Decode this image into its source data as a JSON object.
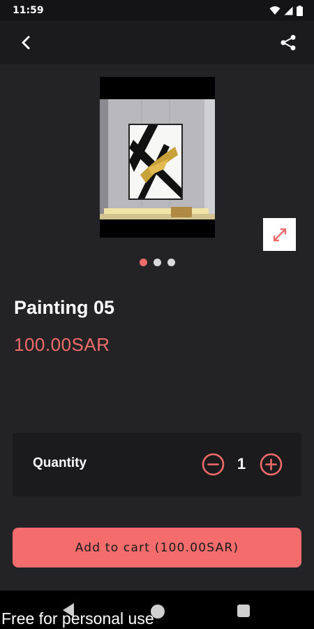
{
  "status_bar": {
    "time": "11:59",
    "icons": [
      "wifi-icon",
      "signal-icon",
      "battery-icon"
    ]
  },
  "app_bar": {
    "back_icon": "back-chevron-icon",
    "share_icon": "share-icon"
  },
  "product": {
    "image": "abstract painting with black and gold brushstrokes hanging in a room",
    "expand_icon": "expand-arrows-icon",
    "carousel": {
      "total": 3,
      "active_index": 0
    },
    "name": "Painting 05",
    "price": "100.00SAR"
  },
  "quantity": {
    "label": "Quantity",
    "value": "1",
    "minus_icon": "minus-circle-icon",
    "plus_icon": "plus-circle-icon"
  },
  "cart": {
    "button_label": "Add to cart (100.00SAR)"
  },
  "nav_bar": {
    "icons": [
      "nav-back-icon",
      "nav-home-icon",
      "nav-recents-icon"
    ]
  },
  "watermark": "Free for personal use",
  "colors": {
    "accent": "#f26b6b",
    "background": "#232326",
    "panel": "#1b1b1d",
    "button": "#f46c6c"
  }
}
